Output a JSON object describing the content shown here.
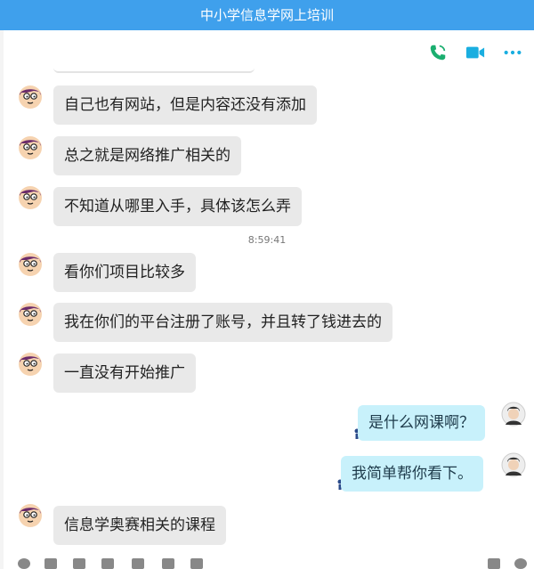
{
  "window": {
    "title": "中小学信息学网上培训"
  },
  "toolbar": {
    "icons": [
      "phone-icon",
      "video-icon",
      "more-icon"
    ]
  },
  "messages": [
    {
      "side": "in",
      "text": "自己也有网站，但是内容还没有添加"
    },
    {
      "side": "in",
      "text": "总之就是网络推广相关的"
    },
    {
      "side": "in",
      "text": "不知道从哪里入手，具体该怎么弄"
    },
    {
      "side": "in",
      "text": "看你们项目比较多"
    },
    {
      "side": "in",
      "text": "我在你们的平台注册了账号，并且转了钱进去的"
    },
    {
      "side": "in",
      "text": "一直没有开始推广"
    },
    {
      "side": "out",
      "text": "是什么网课啊？"
    },
    {
      "side": "out",
      "text": "我简单帮你看下。"
    },
    {
      "side": "in",
      "text": "信息学奥赛相关的课程"
    }
  ],
  "timestamp": "8:59:41",
  "colors": {
    "titlebar": "#3fa0ec",
    "incoming_bubble": "#e9e9e9",
    "outgoing_bubble": "#c8f1fb",
    "icon_accent": "#1aaee0"
  }
}
